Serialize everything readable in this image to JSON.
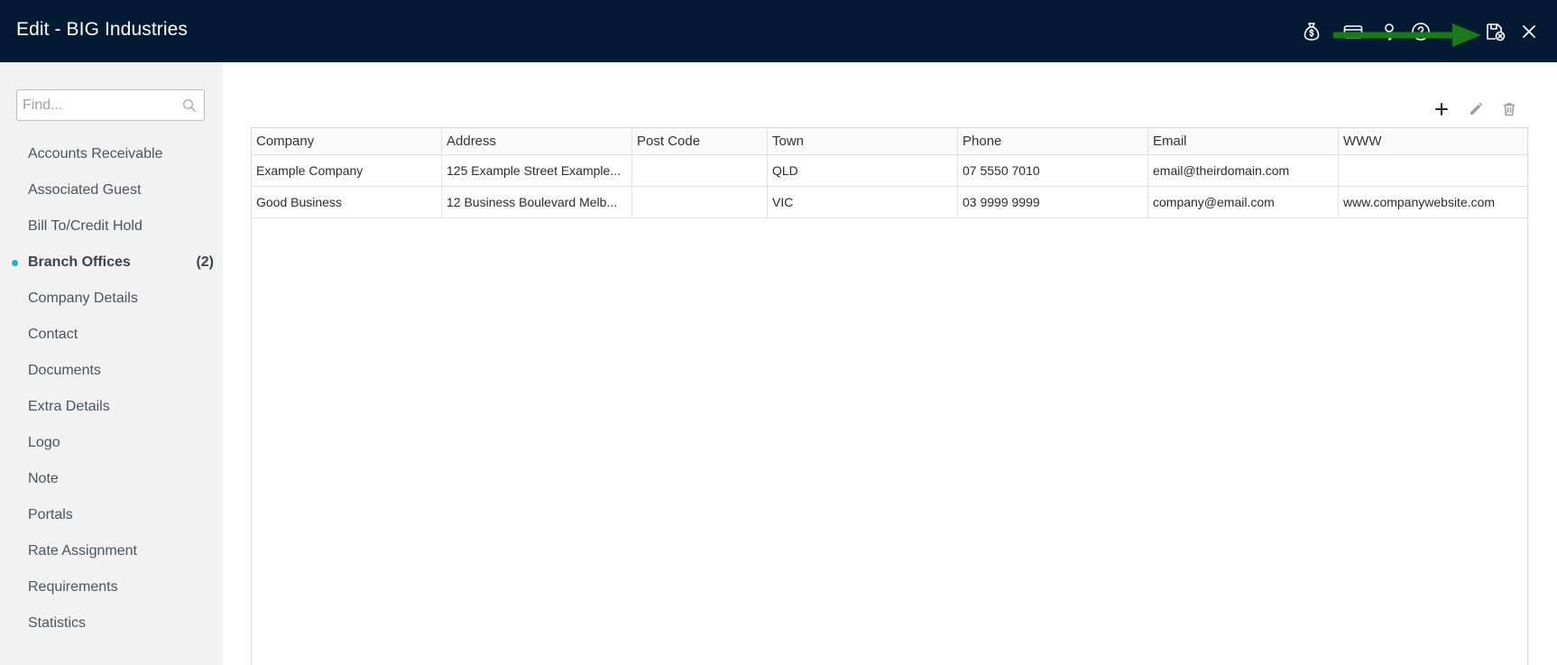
{
  "window": {
    "title": "Edit - BIG Industries"
  },
  "header_icons": [
    "money-bag-icon",
    "card-icon",
    "key-icon",
    "help-icon",
    "save-close-icon",
    "close-icon"
  ],
  "sidebar": {
    "search_placeholder": "Find...",
    "items": [
      {
        "label": "Accounts Receivable",
        "count": ""
      },
      {
        "label": "Associated Guest",
        "count": ""
      },
      {
        "label": "Bill To/Credit Hold",
        "count": ""
      },
      {
        "label": "Branch Offices",
        "count": "(2)",
        "active": true
      },
      {
        "label": "Company Details",
        "count": ""
      },
      {
        "label": "Contact",
        "count": ""
      },
      {
        "label": "Documents",
        "count": ""
      },
      {
        "label": "Extra Details",
        "count": ""
      },
      {
        "label": "Logo",
        "count": ""
      },
      {
        "label": "Note",
        "count": ""
      },
      {
        "label": "Portals",
        "count": ""
      },
      {
        "label": "Rate Assignment",
        "count": ""
      },
      {
        "label": "Requirements",
        "count": ""
      },
      {
        "label": "Statistics",
        "count": ""
      }
    ]
  },
  "toolbar_icons": [
    "add-icon",
    "edit-icon",
    "delete-icon"
  ],
  "table": {
    "columns": [
      "Company",
      "Address",
      "Post Code",
      "Town",
      "Phone",
      "Email",
      "WWW"
    ],
    "rows": [
      [
        "Example Company",
        "125 Example Street Example...",
        "",
        "QLD",
        "07 5550 7010",
        "email@theirdomain.com",
        ""
      ],
      [
        "Good Business",
        "12 Business Boulevard Melb...",
        "",
        "VIC",
        "03 9999 9999",
        "company@email.com",
        "www.companywebsite.com"
      ]
    ]
  },
  "colors": {
    "header_bg": "#031a33",
    "sidebar_bg": "#f2f2f2",
    "active_dot": "#19b6c9",
    "annotation_arrow": "#1a7a1a"
  }
}
